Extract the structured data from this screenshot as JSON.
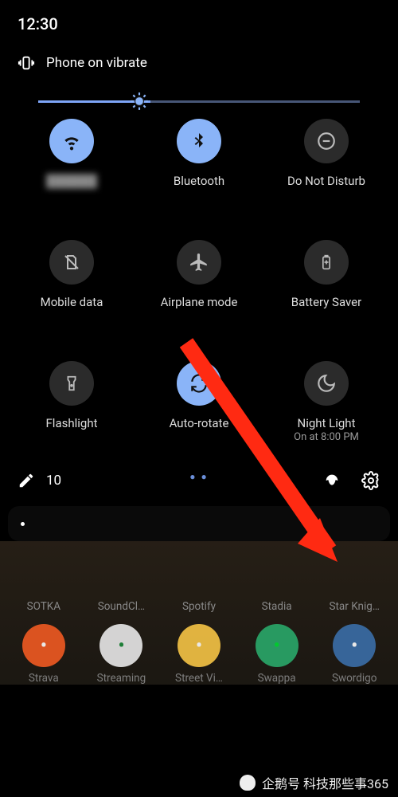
{
  "status": {
    "time": "12:30"
  },
  "ringer": {
    "text": "Phone on vibrate"
  },
  "brightness": {
    "percent": 35
  },
  "tiles": [
    {
      "id": "wifi",
      "label": "",
      "sub": "",
      "state": "on",
      "icon": "wifi",
      "label_blurred": true
    },
    {
      "id": "bluetooth",
      "label": "Bluetooth",
      "sub": "",
      "state": "on",
      "icon": "bluetooth"
    },
    {
      "id": "dnd",
      "label": "Do Not Disturb",
      "sub": "",
      "state": "off",
      "icon": "dnd"
    },
    {
      "id": "mobiledata",
      "label": "Mobile data",
      "sub": "",
      "state": "off",
      "icon": "nosim"
    },
    {
      "id": "airplane",
      "label": "Airplane mode",
      "sub": "",
      "state": "off",
      "icon": "airplane"
    },
    {
      "id": "battery",
      "label": "Battery Saver",
      "sub": "",
      "state": "off",
      "icon": "battery"
    },
    {
      "id": "flashlight",
      "label": "Flashlight",
      "sub": "",
      "state": "off",
      "icon": "flashlight"
    },
    {
      "id": "autorotate",
      "label": "Auto-rotate",
      "sub": "",
      "state": "on",
      "icon": "rotate"
    },
    {
      "id": "nightlight",
      "label": "Night Light",
      "sub": "On at 8:00 PM",
      "state": "off",
      "icon": "moon"
    }
  ],
  "footer": {
    "edit_icon": "edit",
    "user_count": "10",
    "multiuser_icon": "user",
    "settings_icon": "settings"
  },
  "home": {
    "row1": [
      "SOTKA",
      "SoundCl…",
      "Spotify",
      "Stadia",
      "Star Knig…"
    ],
    "row2": [
      {
        "label": "Strava",
        "bg": "#f05a22",
        "fg": "#fff"
      },
      {
        "label": "Streaming",
        "bg": "#e8e8e8",
        "fg": "#1f8a3b"
      },
      {
        "label": "Street Vi…",
        "bg": "#f6c445",
        "fg": "#fff"
      },
      {
        "label": "Swappa",
        "bg": "#2aa86a",
        "fg": "#0d3"
      },
      {
        "label": "Swordigo",
        "bg": "#3a6ea8",
        "fg": "#fff"
      }
    ]
  },
  "watermark": {
    "text": "企鹅号 科技那些事365"
  }
}
